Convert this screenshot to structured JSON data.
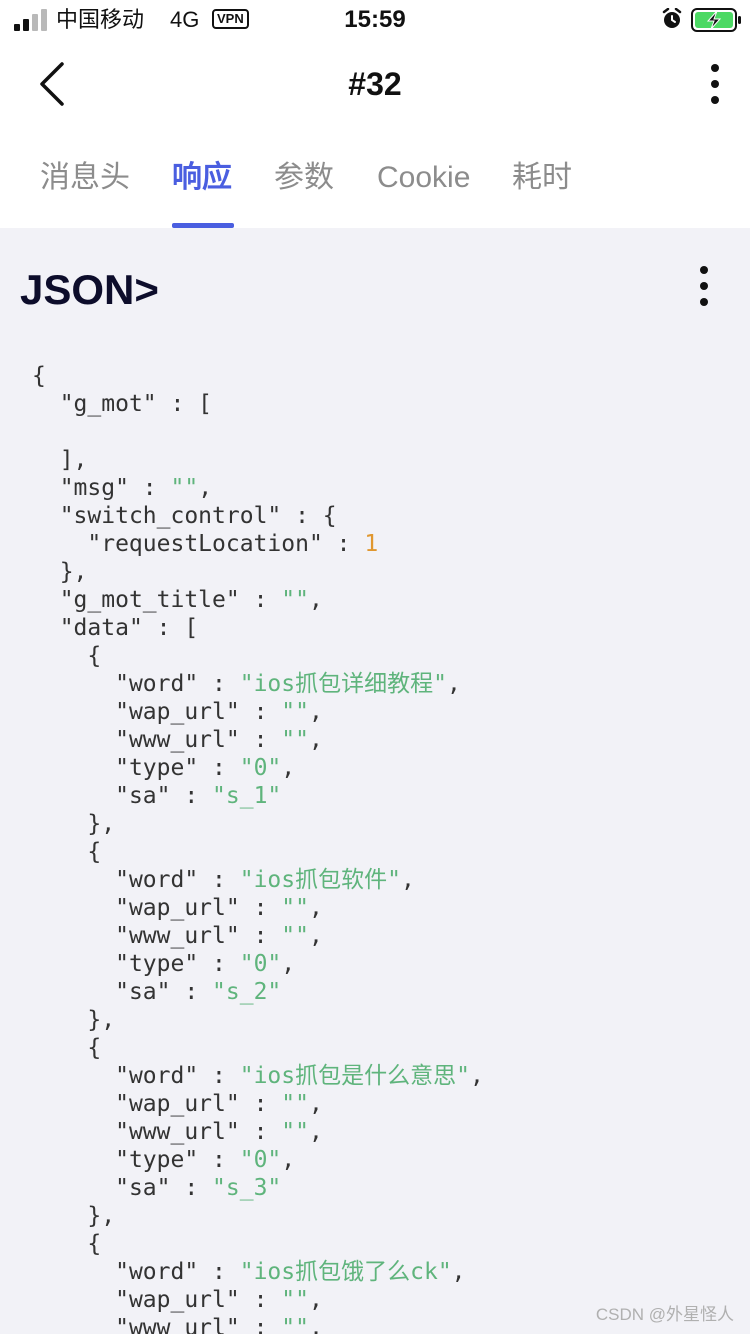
{
  "status_bar": {
    "carrier": "中国移动",
    "network": "4G",
    "vpn": "VPN",
    "time": "15:59"
  },
  "nav": {
    "title": "#32"
  },
  "tabs": [
    {
      "label": "消息头",
      "active": false
    },
    {
      "label": "响应",
      "active": true
    },
    {
      "label": "参数",
      "active": false
    },
    {
      "label": "Cookie",
      "active": false
    },
    {
      "label": "耗时",
      "active": false
    }
  ],
  "json_section": {
    "heading": "JSON>",
    "lines": [
      {
        "indent": 0,
        "parts": [
          {
            "t": "p",
            "v": "{"
          }
        ]
      },
      {
        "indent": 1,
        "parts": [
          {
            "t": "k",
            "v": "\"g_mot\""
          },
          {
            "t": "p",
            "v": " : ["
          }
        ]
      },
      {
        "indent": 0,
        "parts": []
      },
      {
        "indent": 1,
        "parts": [
          {
            "t": "p",
            "v": "],"
          }
        ]
      },
      {
        "indent": 1,
        "parts": [
          {
            "t": "k",
            "v": "\"msg\""
          },
          {
            "t": "p",
            "v": " : "
          },
          {
            "t": "s",
            "v": "\"\""
          },
          {
            "t": "p",
            "v": ","
          }
        ]
      },
      {
        "indent": 1,
        "parts": [
          {
            "t": "k",
            "v": "\"switch_control\""
          },
          {
            "t": "p",
            "v": " : {"
          }
        ]
      },
      {
        "indent": 2,
        "parts": [
          {
            "t": "k",
            "v": "\"requestLocation\""
          },
          {
            "t": "p",
            "v": " : "
          },
          {
            "t": "n",
            "v": "1"
          }
        ]
      },
      {
        "indent": 1,
        "parts": [
          {
            "t": "p",
            "v": "},"
          }
        ]
      },
      {
        "indent": 1,
        "parts": [
          {
            "t": "k",
            "v": "\"g_mot_title\""
          },
          {
            "t": "p",
            "v": " : "
          },
          {
            "t": "s",
            "v": "\"\""
          },
          {
            "t": "p",
            "v": ","
          }
        ]
      },
      {
        "indent": 1,
        "parts": [
          {
            "t": "k",
            "v": "\"data\""
          },
          {
            "t": "p",
            "v": " : ["
          }
        ]
      },
      {
        "indent": 2,
        "parts": [
          {
            "t": "p",
            "v": "{"
          }
        ]
      },
      {
        "indent": 3,
        "parts": [
          {
            "t": "k",
            "v": "\"word\""
          },
          {
            "t": "p",
            "v": " : "
          },
          {
            "t": "s",
            "v": "\"ios抓包详细教程\""
          },
          {
            "t": "p",
            "v": ","
          }
        ]
      },
      {
        "indent": 3,
        "parts": [
          {
            "t": "k",
            "v": "\"wap_url\""
          },
          {
            "t": "p",
            "v": " : "
          },
          {
            "t": "s",
            "v": "\"\""
          },
          {
            "t": "p",
            "v": ","
          }
        ]
      },
      {
        "indent": 3,
        "parts": [
          {
            "t": "k",
            "v": "\"www_url\""
          },
          {
            "t": "p",
            "v": " : "
          },
          {
            "t": "s",
            "v": "\"\""
          },
          {
            "t": "p",
            "v": ","
          }
        ]
      },
      {
        "indent": 3,
        "parts": [
          {
            "t": "k",
            "v": "\"type\""
          },
          {
            "t": "p",
            "v": " : "
          },
          {
            "t": "s",
            "v": "\"0\""
          },
          {
            "t": "p",
            "v": ","
          }
        ]
      },
      {
        "indent": 3,
        "parts": [
          {
            "t": "k",
            "v": "\"sa\""
          },
          {
            "t": "p",
            "v": " : "
          },
          {
            "t": "s",
            "v": "\"s_1\""
          }
        ]
      },
      {
        "indent": 2,
        "parts": [
          {
            "t": "p",
            "v": "},"
          }
        ]
      },
      {
        "indent": 2,
        "parts": [
          {
            "t": "p",
            "v": "{"
          }
        ]
      },
      {
        "indent": 3,
        "parts": [
          {
            "t": "k",
            "v": "\"word\""
          },
          {
            "t": "p",
            "v": " : "
          },
          {
            "t": "s",
            "v": "\"ios抓包软件\""
          },
          {
            "t": "p",
            "v": ","
          }
        ]
      },
      {
        "indent": 3,
        "parts": [
          {
            "t": "k",
            "v": "\"wap_url\""
          },
          {
            "t": "p",
            "v": " : "
          },
          {
            "t": "s",
            "v": "\"\""
          },
          {
            "t": "p",
            "v": ","
          }
        ]
      },
      {
        "indent": 3,
        "parts": [
          {
            "t": "k",
            "v": "\"www_url\""
          },
          {
            "t": "p",
            "v": " : "
          },
          {
            "t": "s",
            "v": "\"\""
          },
          {
            "t": "p",
            "v": ","
          }
        ]
      },
      {
        "indent": 3,
        "parts": [
          {
            "t": "k",
            "v": "\"type\""
          },
          {
            "t": "p",
            "v": " : "
          },
          {
            "t": "s",
            "v": "\"0\""
          },
          {
            "t": "p",
            "v": ","
          }
        ]
      },
      {
        "indent": 3,
        "parts": [
          {
            "t": "k",
            "v": "\"sa\""
          },
          {
            "t": "p",
            "v": " : "
          },
          {
            "t": "s",
            "v": "\"s_2\""
          }
        ]
      },
      {
        "indent": 2,
        "parts": [
          {
            "t": "p",
            "v": "},"
          }
        ]
      },
      {
        "indent": 2,
        "parts": [
          {
            "t": "p",
            "v": "{"
          }
        ]
      },
      {
        "indent": 3,
        "parts": [
          {
            "t": "k",
            "v": "\"word\""
          },
          {
            "t": "p",
            "v": " : "
          },
          {
            "t": "s",
            "v": "\"ios抓包是什么意思\""
          },
          {
            "t": "p",
            "v": ","
          }
        ]
      },
      {
        "indent": 3,
        "parts": [
          {
            "t": "k",
            "v": "\"wap_url\""
          },
          {
            "t": "p",
            "v": " : "
          },
          {
            "t": "s",
            "v": "\"\""
          },
          {
            "t": "p",
            "v": ","
          }
        ]
      },
      {
        "indent": 3,
        "parts": [
          {
            "t": "k",
            "v": "\"www_url\""
          },
          {
            "t": "p",
            "v": " : "
          },
          {
            "t": "s",
            "v": "\"\""
          },
          {
            "t": "p",
            "v": ","
          }
        ]
      },
      {
        "indent": 3,
        "parts": [
          {
            "t": "k",
            "v": "\"type\""
          },
          {
            "t": "p",
            "v": " : "
          },
          {
            "t": "s",
            "v": "\"0\""
          },
          {
            "t": "p",
            "v": ","
          }
        ]
      },
      {
        "indent": 3,
        "parts": [
          {
            "t": "k",
            "v": "\"sa\""
          },
          {
            "t": "p",
            "v": " : "
          },
          {
            "t": "s",
            "v": "\"s_3\""
          }
        ]
      },
      {
        "indent": 2,
        "parts": [
          {
            "t": "p",
            "v": "},"
          }
        ]
      },
      {
        "indent": 2,
        "parts": [
          {
            "t": "p",
            "v": "{"
          }
        ]
      },
      {
        "indent": 3,
        "parts": [
          {
            "t": "k",
            "v": "\"word\""
          },
          {
            "t": "p",
            "v": " : "
          },
          {
            "t": "s",
            "v": "\"ios抓包饿了么ck\""
          },
          {
            "t": "p",
            "v": ","
          }
        ]
      },
      {
        "indent": 3,
        "parts": [
          {
            "t": "k",
            "v": "\"wap_url\""
          },
          {
            "t": "p",
            "v": " : "
          },
          {
            "t": "s",
            "v": "\"\""
          },
          {
            "t": "p",
            "v": ","
          }
        ]
      },
      {
        "indent": 3,
        "parts": [
          {
            "t": "k",
            "v": "\"www_url\""
          },
          {
            "t": "p",
            "v": " : "
          },
          {
            "t": "s",
            "v": "\"\""
          },
          {
            "t": "p",
            "v": ","
          }
        ]
      }
    ]
  },
  "watermark": "CSDN @外星怪人",
  "icons": {
    "back": "chevron-left-icon",
    "more": "more-vertical-icon",
    "alarm": "alarm-icon",
    "battery": "battery-charging-icon"
  },
  "colors": {
    "accent": "#4a5ee0",
    "string": "#5fb47c",
    "number": "#e0972f",
    "battery_fill": "#4cd964"
  }
}
